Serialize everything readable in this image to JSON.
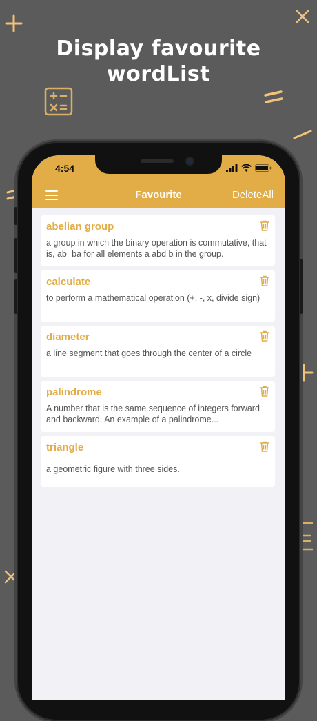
{
  "headline": {
    "line1": "Display favourite",
    "line2": "wordList"
  },
  "status": {
    "time": "4:54"
  },
  "navbar": {
    "title": "Favourite",
    "delete_all_label": "DeleteAll"
  },
  "words": [
    {
      "word": "abelian group",
      "definition": "a group in which the binary operation is commutative, that is, ab=ba for all elements a abd b in the group."
    },
    {
      "word": "calculate",
      "definition": "to perform a mathematical operation (+, -, x, divide sign)"
    },
    {
      "word": "diameter",
      "definition": "a line segment that goes through the center of a circle"
    },
    {
      "word": "palindrome",
      "definition": "A number that is the same sequence of integers forward and backward. An example of a palindrome..."
    },
    {
      "word": "triangle",
      "definition": "a geometric figure with three sides."
    }
  ],
  "icons": {
    "menu": "hamburger-menu-icon",
    "delete": "trash-icon",
    "wifi": "wifi-icon",
    "battery": "battery-icon",
    "signal": "cellular-signal-icon"
  },
  "colors": {
    "accent": "#e2ac46",
    "background": "#5b5b5b",
    "screen_bg": "#f2f1f6",
    "card_bg": "#ffffff",
    "definition_text": "#555555"
  }
}
